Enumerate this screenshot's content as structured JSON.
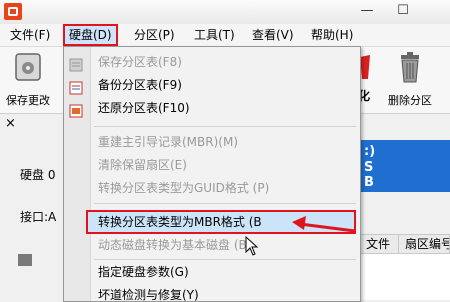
{
  "window": {
    "app_icon": "partition-tool-icon",
    "controls": {
      "minimize": "—",
      "maximize": "☐"
    }
  },
  "menubar": {
    "items": [
      "文件(F)",
      "硬盘(D)",
      "分区(P)",
      "工具(T)",
      "查看(V)",
      "帮助(H)"
    ],
    "active_index": 1
  },
  "toolbar": {
    "buttons": [
      {
        "label": "保存更改",
        "icon": "save-disk-icon"
      },
      {
        "label": "化",
        "icon": "format-icon"
      },
      {
        "label": "删除分区",
        "icon": "trash-icon"
      }
    ]
  },
  "leftpane": {
    "close_glyph": "×",
    "disk_label": "硬盘 0",
    "port_label": "接口:A"
  },
  "disk_panel": {
    "line1": ":)",
    "line2": "S",
    "line3": "B",
    "color": "#1f6fd0"
  },
  "grid": {
    "headers": [
      "",
      "文件",
      "扇区编号"
    ]
  },
  "dropdown": {
    "items": [
      {
        "label": "保存分区表(F8)",
        "enabled": false,
        "icon": "save-table-icon"
      },
      {
        "label": "备份分区表(F9)",
        "enabled": true,
        "icon": "backup-table-icon"
      },
      {
        "label": "还原分区表(F10)",
        "enabled": true,
        "icon": "restore-table-icon"
      },
      {
        "label": "重建主引导记录(MBR)(M)",
        "enabled": false
      },
      {
        "label": "清除保留扇区(E)",
        "enabled": false
      },
      {
        "label": "转换分区表类型为GUID格式 (P)",
        "enabled": false
      },
      {
        "label": "转换分区表类型为MBR格式 (B",
        "enabled": true,
        "highlighted": true
      },
      {
        "label": "动态磁盘转换为基本磁盘 (B)",
        "enabled": false
      },
      {
        "label": "指定硬盘参数(G)",
        "enabled": true
      },
      {
        "label": "坏道检测与修复(Y)",
        "enabled": true
      }
    ],
    "highlight_color": "#e0141e"
  }
}
